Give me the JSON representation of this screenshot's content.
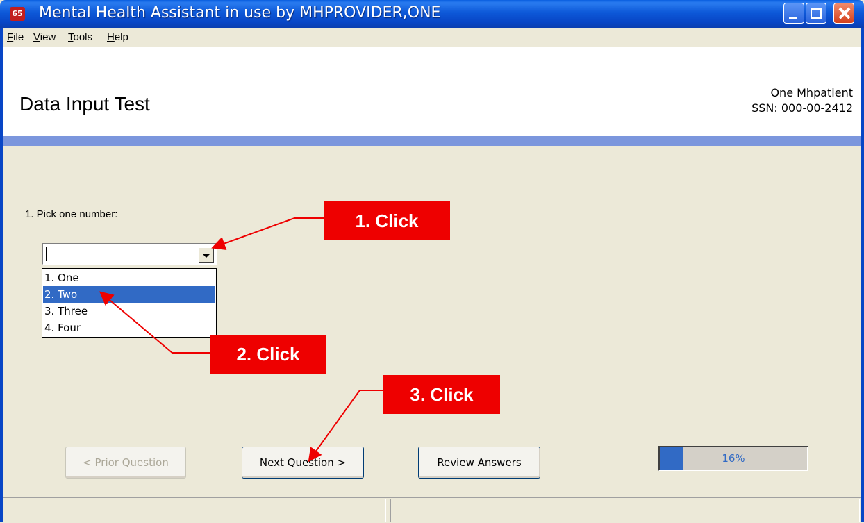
{
  "window": {
    "title": "Mental Health Assistant in use by MHPROVIDER,ONE",
    "app_icon_text": "65"
  },
  "menu": [
    {
      "label": "File",
      "underline": "F",
      "rest": "ile"
    },
    {
      "label": "View",
      "underline": "V",
      "rest": "iew"
    },
    {
      "label": "Tools",
      "underline": "T",
      "rest": "ools"
    },
    {
      "label": "Help",
      "underline": "H",
      "rest": "elp"
    }
  ],
  "header": {
    "title": "Data Input Test",
    "patient_name": "One Mhpatient",
    "patient_ssn": "SSN: 000-00-2412",
    "band_color": "#7b96dd"
  },
  "question": {
    "label": "1. Pick one number:",
    "combo_value": "",
    "options": [
      "1. One",
      "2. Two",
      "3. Three",
      "4. Four"
    ],
    "highlighted_index": 1
  },
  "buttons": {
    "prior": "< Prior Question",
    "prior_enabled": false,
    "next": "Next Question >",
    "review": "Review Answers"
  },
  "progress": {
    "value": 0.16,
    "label": "16%"
  },
  "callouts": {
    "step1": "1. Click",
    "step2": "2. Click",
    "step3": "3. Click",
    "color": "#ee0000"
  }
}
